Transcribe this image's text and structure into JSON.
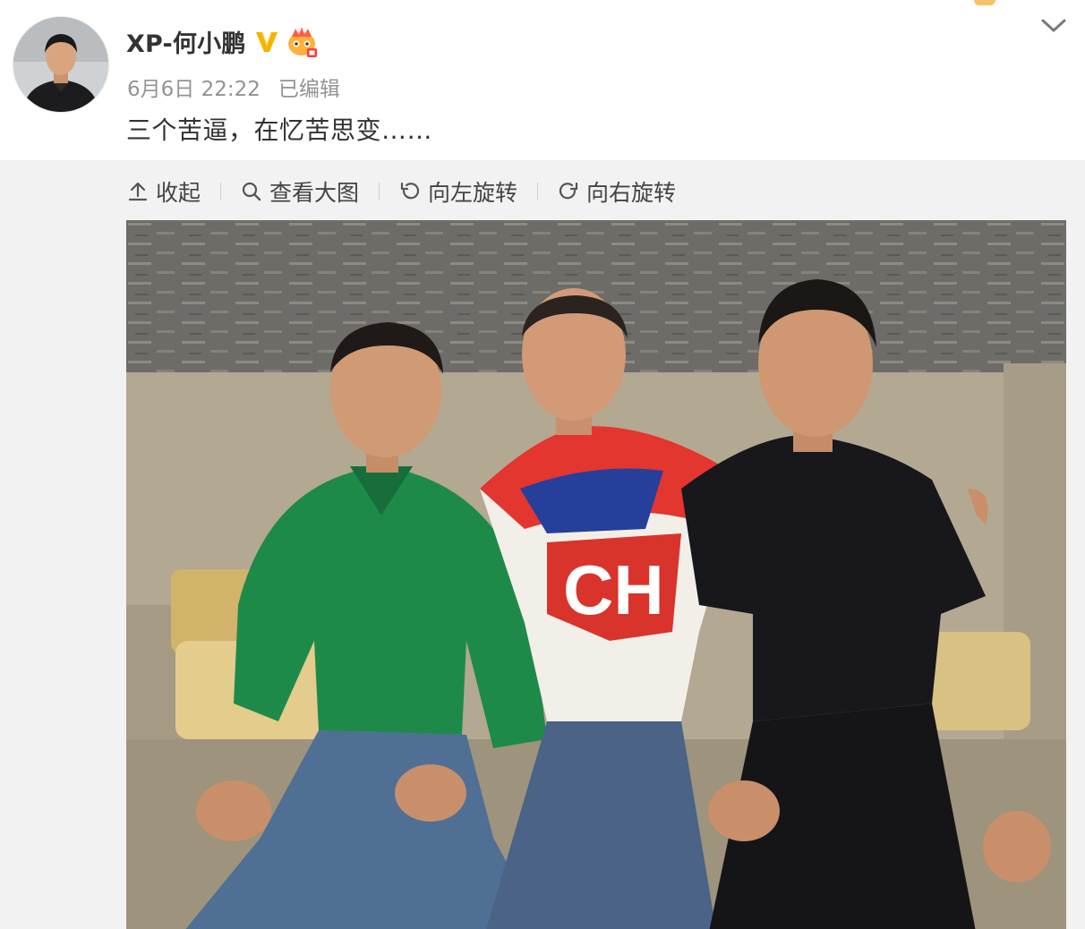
{
  "post": {
    "author": "XP-何小鹏",
    "date": "6月6日 22:22",
    "edited_label": "已编辑",
    "content": "三个苦逼，在忆苦思变……"
  },
  "icons": {
    "verified": "verified-v-icon",
    "vip": "vip-crown-icon",
    "expand": "chevron-down-icon"
  },
  "toolbar": {
    "collapse": "收起",
    "view_large": "查看大图",
    "rotate_left": "向左旋转",
    "rotate_right": "向右旋转"
  },
  "photo": {
    "shirt_text": "CH"
  },
  "colors": {
    "verified": "#f4b400",
    "toolbar_bg": "#f2f2f2",
    "meta": "#939393",
    "text": "#333333"
  }
}
